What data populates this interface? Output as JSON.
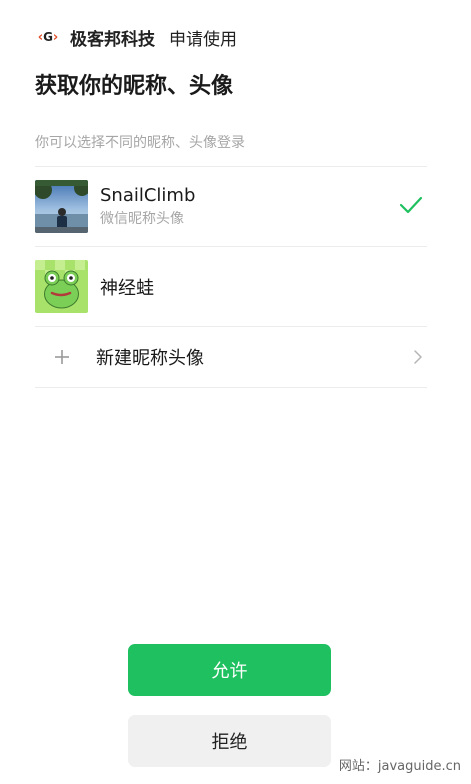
{
  "header": {
    "logo_text": "G",
    "app_name": "极客邦科技",
    "action_text": "申请使用"
  },
  "title": "获取你的昵称、头像",
  "subtitle": "你可以选择不同的昵称、头像登录",
  "options": [
    {
      "name": "SnailClimb",
      "sub": "微信昵称头像",
      "selected": true,
      "avatar_icon": "avatar-photo-icon"
    },
    {
      "name": "神经蛙",
      "selected": false,
      "avatar_icon": "frog-avatar-icon"
    }
  ],
  "new_option": {
    "label": "新建昵称头像",
    "icon": "plus-icon"
  },
  "buttons": {
    "allow": "允许",
    "deny": "拒绝"
  },
  "watermark": "网站：javaguide.cn",
  "colors": {
    "accent": "#1fc05f",
    "muted": "#a6a6a6"
  }
}
